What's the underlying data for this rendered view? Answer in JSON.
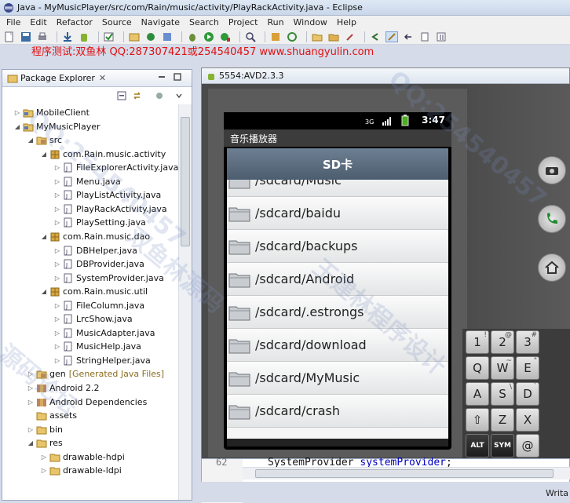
{
  "window": {
    "title": "Java - MyMusicPlayer/src/com/Rain/music/activity/PlayRackActivity.java - Eclipse"
  },
  "menu": [
    "File",
    "Edit",
    "Refactor",
    "Source",
    "Navigate",
    "Search",
    "Project",
    "Run",
    "Window",
    "Help"
  ],
  "banner": "程序测试:双鱼林 QQ:287307421或254540457 www.shuangyulin.com",
  "package_explorer": {
    "title": "Package Explorer",
    "tree": [
      {
        "label": "MobileClient",
        "depth": 0,
        "icon": "project-icon",
        "arrow": "▷"
      },
      {
        "label": "MyMusicPlayer",
        "depth": 0,
        "icon": "project-icon",
        "arrow": "◢"
      },
      {
        "label": "src",
        "depth": 1,
        "icon": "source-folder-icon",
        "arrow": "◢"
      },
      {
        "label": "com.Rain.music.activity",
        "depth": 2,
        "icon": "package-icon",
        "arrow": "◢"
      },
      {
        "label": "FileExplorerActivity.java",
        "depth": 3,
        "icon": "java-file-icon",
        "arrow": "▷"
      },
      {
        "label": "Menu.java",
        "depth": 3,
        "icon": "java-file-icon",
        "arrow": "▷"
      },
      {
        "label": "PlayListActivity.java",
        "depth": 3,
        "icon": "java-file-icon",
        "arrow": "▷"
      },
      {
        "label": "PlayRackActivity.java",
        "depth": 3,
        "icon": "java-file-icon",
        "arrow": "▷"
      },
      {
        "label": "PlaySetting.java",
        "depth": 3,
        "icon": "java-file-icon",
        "arrow": "▷"
      },
      {
        "label": "com.Rain.music.dao",
        "depth": 2,
        "icon": "package-icon",
        "arrow": "◢"
      },
      {
        "label": "DBHelper.java",
        "depth": 3,
        "icon": "java-file-icon",
        "arrow": "▷"
      },
      {
        "label": "DBProvider.java",
        "depth": 3,
        "icon": "java-file-icon",
        "arrow": "▷"
      },
      {
        "label": "SystemProvider.java",
        "depth": 3,
        "icon": "java-file-icon",
        "arrow": "▷"
      },
      {
        "label": "com.Rain.music.util",
        "depth": 2,
        "icon": "package-icon",
        "arrow": "◢"
      },
      {
        "label": "FileColumn.java",
        "depth": 3,
        "icon": "java-file-icon",
        "arrow": "▷"
      },
      {
        "label": "LrcShow.java",
        "depth": 3,
        "icon": "java-file-icon",
        "arrow": "▷"
      },
      {
        "label": "MusicAdapter.java",
        "depth": 3,
        "icon": "java-file-icon",
        "arrow": "▷"
      },
      {
        "label": "MusicHelp.java",
        "depth": 3,
        "icon": "java-file-icon",
        "arrow": "▷"
      },
      {
        "label": "StringHelper.java",
        "depth": 3,
        "icon": "java-file-icon",
        "arrow": "▷"
      },
      {
        "label": "gen",
        "suffix": "[Generated Java Files]",
        "depth": 1,
        "icon": "source-folder-icon",
        "arrow": "▷"
      },
      {
        "label": "Android 2.2",
        "depth": 1,
        "icon": "library-icon",
        "arrow": "▷"
      },
      {
        "label": "Android Dependencies",
        "depth": 1,
        "icon": "library-icon",
        "arrow": "▷"
      },
      {
        "label": "assets",
        "depth": 1,
        "icon": "folder-icon",
        "arrow": ""
      },
      {
        "label": "bin",
        "depth": 1,
        "icon": "folder-icon",
        "arrow": "▷"
      },
      {
        "label": "res",
        "depth": 1,
        "icon": "folder-icon",
        "arrow": "◢"
      },
      {
        "label": "drawable-hdpi",
        "depth": 2,
        "icon": "folder-icon",
        "arrow": "▷"
      },
      {
        "label": "drawable-ldpi",
        "depth": 2,
        "icon": "folder-icon",
        "arrow": "▷"
      }
    ]
  },
  "emulator": {
    "title": "5554:AVD2.3.3",
    "status_time": "3:47",
    "app_title": "音乐播放器",
    "header": "SD卡",
    "items": [
      "/sdcard/Music",
      "/sdcard/baidu",
      "/sdcard/backups",
      "/sdcard/Android",
      "/sdcard/.estrongs",
      "/sdcard/download",
      "/sdcard/MyMusic",
      "/sdcard/crash"
    ],
    "keys": [
      {
        "k": "1",
        "s": "!"
      },
      {
        "k": "2",
        "s": "@"
      },
      {
        "k": "3",
        "s": "#"
      },
      {
        "k": "Q",
        "s": ""
      },
      {
        "k": "W",
        "s": "~"
      },
      {
        "k": "E",
        "s": "\""
      },
      {
        "k": "A",
        "s": ""
      },
      {
        "k": "S",
        "s": "\\"
      },
      {
        "k": "D",
        "s": "`"
      },
      {
        "k": "⇧",
        "s": ""
      },
      {
        "k": "Z",
        "s": ""
      },
      {
        "k": "X",
        "s": ""
      },
      {
        "k": "ALT",
        "s": ""
      },
      {
        "k": "SYM",
        "s": ""
      },
      {
        "k": "@",
        "s": ""
      }
    ]
  },
  "editor": {
    "line_number": "62",
    "code_type": "SystemProvider",
    "code_field": "systemProvider",
    "code_end": ";"
  },
  "statusbar": {
    "mode": "Writa"
  },
  "watermarks": [
    "QQ:254540457",
    "双鱼林源码",
    "王建林程序设计",
    "源码论坛"
  ]
}
